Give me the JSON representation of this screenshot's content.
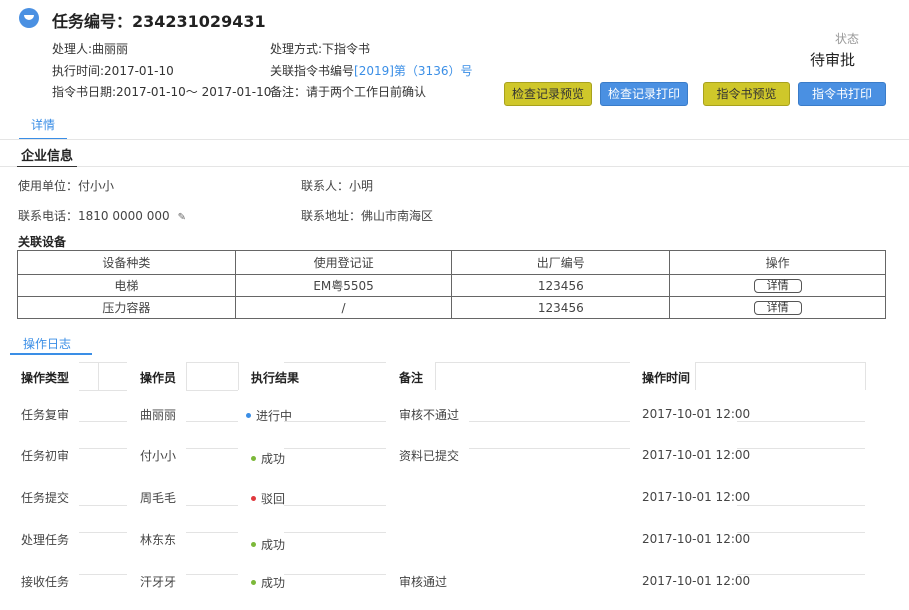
{
  "header": {
    "title": "任务编号：234231029431",
    "handler": "处理人:曲丽丽",
    "exec_time": "执行时间:2017-01-10",
    "order_date": "指令书日期:2017-01-10〜 2017-01-10",
    "method": "处理方式:下指令书",
    "related_prefix": "关联指令书编号",
    "related_link": "[2019]第（3136）号",
    "remark": "备注：请于两个工作日前确认",
    "status_label": "状态",
    "status_value": "待审批"
  },
  "buttons": {
    "check_preview": "检查记录预览",
    "check_print": "检查记录打印",
    "order_preview": "指令书预览",
    "order_print": "指令书打印"
  },
  "tabs": {
    "detail": "详情",
    "log": "操作日志"
  },
  "company": {
    "section_title": "企业信息",
    "unit": "使用单位：付小小",
    "contact": "联系人：小明",
    "phone": "联系电话：1810 0000 000",
    "address": "联系地址：佛山市南海区"
  },
  "devices": {
    "section_title": "关联设备",
    "headers": [
      "设备种类",
      "使用登记证",
      "出厂编号",
      "操作"
    ],
    "rows": [
      {
        "type": "电梯",
        "cert": "EM粤5505",
        "serial": "123456",
        "action": "详情"
      },
      {
        "type": "压力容器",
        "cert": "/",
        "serial": "123456",
        "action": "详情"
      }
    ]
  },
  "log": {
    "headers": [
      "操作类型",
      "操作员",
      "执行结果",
      "备注",
      "操作时间"
    ],
    "rows": [
      {
        "type": "任务复审",
        "operator": "曲丽丽",
        "result": "进行中",
        "remark": "审核不通过",
        "time": "2017-10-01 12:00"
      },
      {
        "type": "任务初审",
        "operator": "付小小",
        "result": "成功",
        "remark": "资料已提交",
        "time": "2017-10-01 12:00"
      },
      {
        "type": "任务提交",
        "operator": "周毛毛",
        "result": "驳回",
        "remark": "",
        "time": "2017-10-01 12:00"
      },
      {
        "type": "处理任务",
        "operator": "林东东",
        "result": "成功",
        "remark": "",
        "time": "2017-10-01 12:00"
      },
      {
        "type": "接收任务",
        "operator": "汗牙牙",
        "result": "成功",
        "remark": "审核通过",
        "time": "2017-10-01 12:00"
      }
    ]
  },
  "colors": {
    "accent": "#3a8ee6",
    "olive_button": "#cfc72a",
    "blue_button": "#4a90e2",
    "status_running": "#3a8ee6",
    "status_success": "#7cb83a",
    "status_rejected": "#e0393e"
  },
  "icons": {
    "header": "task-icon",
    "edit": "edit-icon"
  }
}
